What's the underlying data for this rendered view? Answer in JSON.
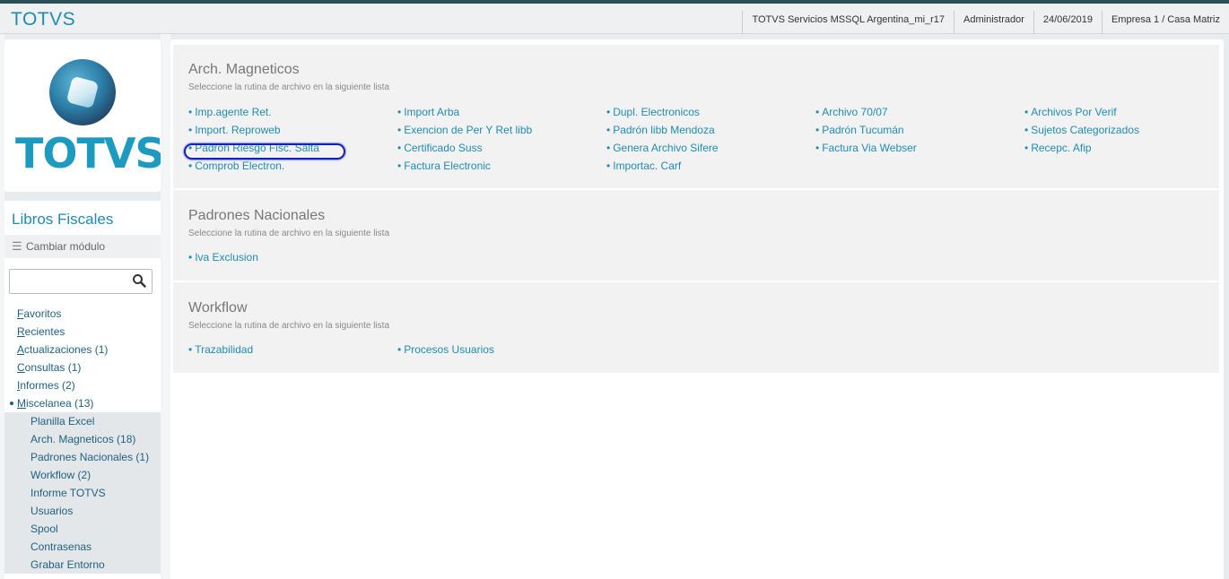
{
  "header": {
    "brand": "TOTVS",
    "environment": "TOTVS Servicios MSSQL Argentina_mi_r17",
    "user": "Administrador",
    "date": "24/06/2019",
    "company": "Empresa 1 / Casa Matriz"
  },
  "logo": {
    "text": "TOTVS"
  },
  "sidebar": {
    "module_title": "Libros Fiscales",
    "change_module": "Cambiar módulo",
    "search": {
      "value": "",
      "placeholder": ""
    },
    "items": [
      {
        "first": "F",
        "rest": "avoritos"
      },
      {
        "first": "R",
        "rest": "ecientes"
      },
      {
        "first": "A",
        "rest": "ctualizaciones (1)"
      },
      {
        "first": "C",
        "rest": "onsultas (1)"
      },
      {
        "first": "I",
        "rest": "nformes (2)"
      },
      {
        "first": "M",
        "rest": "iscelanea (13)"
      }
    ],
    "subitems": [
      "Planilla Excel",
      "Arch. Magneticos (18)",
      "Padrones Nacionales (1)",
      "Workflow (2)",
      "Informe TOTVS",
      "Usuarios",
      "Spool",
      "Contrasenas",
      "Grabar Entorno"
    ]
  },
  "sections": [
    {
      "title": "Arch. Magneticos",
      "subtitle": "Seleccione la rutina de archivo en la siguiente lista",
      "columns": [
        [
          "Imp.agente Ret.",
          "Import. Reproweb",
          "Padron Riesgo Fisc. Salta",
          "Comprob Electron."
        ],
        [
          "Import Arba",
          "Exencion de Per Y Ret libb",
          "Certificado Suss",
          "Factura Electronic"
        ],
        [
          "Dupl. Electronicos",
          "Padrón libb Mendoza",
          "Genera Archivo Sifere",
          "Importac. Carf"
        ],
        [
          "Archivo 70/07",
          "Padrón Tucumán",
          "Factura Via Webser"
        ],
        [
          "Archivos Por Verif",
          "Sujetos Categorizados",
          "Recepc. Afip"
        ]
      ]
    },
    {
      "title": "Padrones Nacionales",
      "subtitle": "Seleccione la rutina de archivo en la siguiente lista",
      "columns": [
        [
          "Iva Exclusion"
        ]
      ]
    },
    {
      "title": "Workflow",
      "subtitle": "Seleccione la rutina de archivo en la siguiente lista",
      "columns": [
        [
          "Trazabilidad"
        ],
        [
          "Procesos Usuarios"
        ]
      ]
    }
  ],
  "bullet": "•",
  "icons": {
    "search": "search-icon",
    "menu": "hamburger-icon"
  },
  "colors": {
    "accent": "#1f8bb1",
    "highlight": "#1122bb"
  }
}
